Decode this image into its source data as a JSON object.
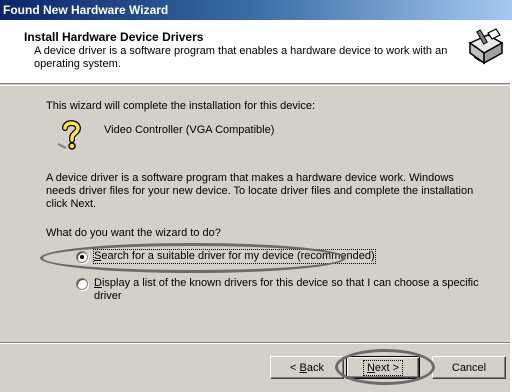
{
  "window": {
    "title": "Found New Hardware Wizard"
  },
  "header": {
    "title": "Install Hardware Device Drivers",
    "description": "A device driver is a software program that enables a hardware device to work with an operating system.",
    "icon": "hardware-wizard-icon"
  },
  "content": {
    "intro": "This wizard will complete the installation for this device:",
    "device_icon": "question-mark-icon",
    "device_name": "Video Controller (VGA Compatible)",
    "explanation": "A device driver is a software program that makes a hardware device work. Windows needs driver files for your new device. To locate driver files and complete the installation click Next.",
    "question": "What do you want the wizard to do?",
    "options": [
      {
        "accel": "S",
        "rest": "earch for a suitable driver for my device (recommended)",
        "checked": true
      },
      {
        "accel": "D",
        "rest": "isplay a list of the known drivers for this device so that I can choose a specific driver",
        "checked": false
      }
    ]
  },
  "buttons": {
    "back": {
      "pre": "< ",
      "accel": "B",
      "rest": "ack"
    },
    "next": {
      "accel": "N",
      "rest": "ext >"
    },
    "cancel": "Cancel"
  },
  "colors": {
    "title_start": "#0a246a",
    "title_end": "#a6caf0",
    "face": "#d4d0c8",
    "annotation": "#6b6b6b"
  }
}
